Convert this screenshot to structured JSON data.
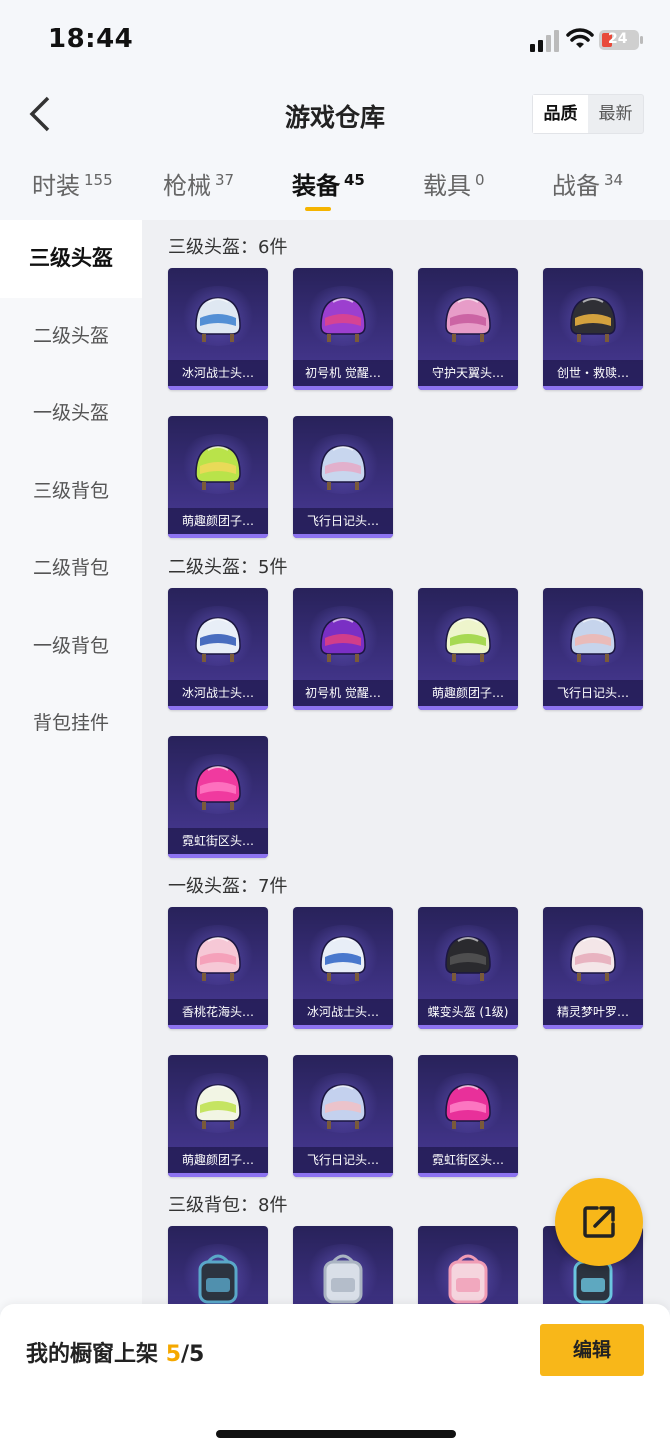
{
  "status": {
    "time": "18:44",
    "battery": "24"
  },
  "header": {
    "title": "游戏仓库",
    "sort_quality": "品质",
    "sort_latest": "最新"
  },
  "tabs": [
    {
      "label": "时装",
      "count": "155"
    },
    {
      "label": "枪械",
      "count": "37"
    },
    {
      "label": "装备",
      "count": "45"
    },
    {
      "label": "载具",
      "count": "0"
    },
    {
      "label": "战备",
      "count": "34"
    }
  ],
  "sidebar": [
    "三级头盔",
    "二级头盔",
    "一级头盔",
    "三级背包",
    "二级背包",
    "一级背包",
    "背包挂件"
  ],
  "sections": [
    {
      "title": "三级头盔：6件",
      "items": [
        "冰河战士头…",
        "初号机 觉醒…",
        "守护天翼头…",
        "创世・救赎…",
        "萌趣颜团子…",
        "飞行日记头…"
      ]
    },
    {
      "title": "二级头盔：5件",
      "items": [
        "冰河战士头…",
        "初号机 觉醒…",
        "萌趣颜团子…",
        "飞行日记头…",
        "霓虹街区头…"
      ]
    },
    {
      "title": "一级头盔：7件",
      "items": [
        "香桃花海头…",
        "冰河战士头…",
        "蝶变头盔 (1级)",
        "精灵梦叶罗…",
        "萌趣颜团子…",
        "飞行日记头…",
        "霓虹街区头…"
      ]
    },
    {
      "title": "三级背包：8件",
      "items": [
        "",
        "",
        "",
        ""
      ]
    }
  ],
  "footer": {
    "showcase_label": "我的橱窗上架",
    "showcase_current": "5",
    "showcase_total": "/5",
    "edit_label": "编辑"
  }
}
